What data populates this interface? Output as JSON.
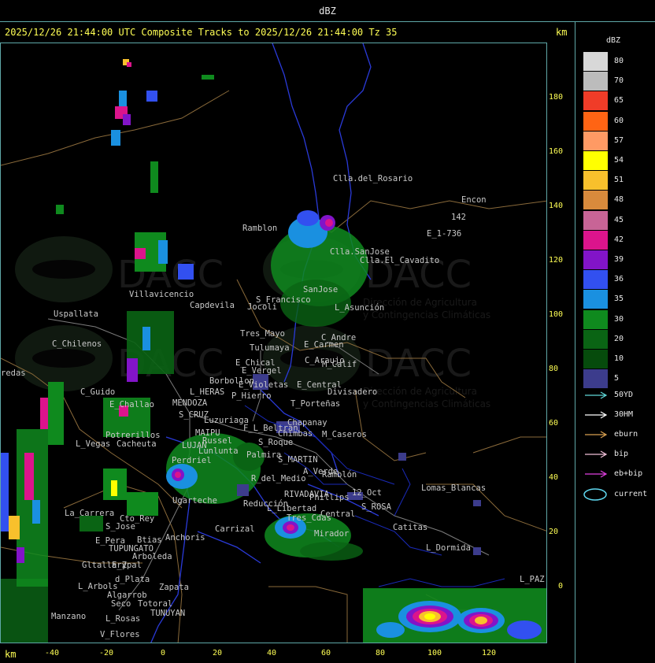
{
  "window": {
    "title": "dBZ"
  },
  "header": {
    "text": "2025/12/26 21:44:00 UTC Composite Tracks to 2025/12/26 21:44:00 Tz 35",
    "km_unit": "km",
    "km_unit_bottom": "km"
  },
  "axes": {
    "y_ticks": [
      "180",
      "160",
      "140",
      "120",
      "100",
      "80",
      "60",
      "40",
      "20",
      "0"
    ],
    "x_ticks": [
      "-40",
      "-20",
      "0",
      "20",
      "40",
      "60",
      "80",
      "100",
      "120"
    ]
  },
  "watermark": {
    "brand": "DACC",
    "line1": "Dirección de Agricultura",
    "line2": "y Contingencias Climáticas"
  },
  "places": [
    "Clla.del_Rosario",
    "Encon",
    "142",
    "E_1-736",
    "Ramblon",
    "Clla.SanJose",
    "Clla.El_Cavadito",
    "Villavicencio",
    "Capdevila",
    "S_Francisco",
    "SanJose",
    "L_Asunción",
    "Uspallata",
    "Tres_Mayo",
    "Jocoli",
    "C_Andre",
    "E_Carmen",
    "C_Chilenos",
    "Tulumaya",
    "E_Chical",
    "C_Araujo",
    "M_Calif",
    "E_Vergel",
    "Borbollon",
    "redas",
    "E_Violetas",
    "E_Central",
    "Divisadero",
    "P_Hierro",
    "L_HERAS",
    "C_Guido",
    "E_Challao",
    "MENDOZA",
    "T_Porteñas",
    "S_CRUZ",
    "Luzuriaga",
    "F_L_Beltran",
    "Chapanay",
    "Chimbas",
    "M_Caseros",
    "Potrerillos",
    "MAIPU",
    "Russel",
    "S_Roque",
    "L_Vegas",
    "Cacheuta",
    "LUJAN",
    "Lunlunta",
    "Palmira",
    "S_MARTIN",
    "Perdriel",
    "A_Verde",
    "Ramblón",
    "R_del_Medio",
    "RIVADAVIA",
    "12_Oct",
    "Lomas_Blancas",
    "Ugarteche",
    "Reducción",
    "Phillips",
    "S_ROSA",
    "La_Carrera",
    "Cto_Rey",
    "S_Jose",
    "L_Libertad",
    "Catitas",
    "Carrizal",
    "Tres_Cdas",
    "Central",
    "E_Pera",
    "Anchoris",
    "Mirador",
    "Btias",
    "TUPUNGATO",
    "L_Dormida",
    "Arboleda",
    "Gltallary",
    "E_Zpal",
    "L_Arbols",
    "d_Plata",
    "Zapata",
    "Algarrob",
    "Seco",
    "Totoral",
    "L_PAZ",
    "TUNUYAN",
    "Manzano",
    "L_Rosas",
    "V_Flores"
  ],
  "legend": {
    "title": "dBZ",
    "scale": [
      {
        "value": "80",
        "color": "#d8d8d8"
      },
      {
        "value": "70",
        "color": "#bcbcbc"
      },
      {
        "value": "65",
        "color": "#f03c28"
      },
      {
        "value": "60",
        "color": "#ff6414"
      },
      {
        "value": "57",
        "color": "#ff9a64"
      },
      {
        "value": "54",
        "color": "#ffff00"
      },
      {
        "value": "51",
        "color": "#f8c02c"
      },
      {
        "value": "48",
        "color": "#d88a3c"
      },
      {
        "value": "45",
        "color": "#c86496"
      },
      {
        "value": "42",
        "color": "#dc148c"
      },
      {
        "value": "39",
        "color": "#8214c8"
      },
      {
        "value": "36",
        "color": "#3250f0"
      },
      {
        "value": "35",
        "color": "#1a90e0"
      },
      {
        "value": "30",
        "color": "#0f8a1e"
      },
      {
        "value": "20",
        "color": "#0a6414"
      },
      {
        "value": "10",
        "color": "#064b0c"
      },
      {
        "value": "5",
        "color": "#3c3c8c"
      }
    ],
    "tracks": [
      {
        "label": "50YD",
        "color": "#5fd8d8"
      },
      {
        "label": "30HM",
        "color": "#ffffff"
      },
      {
        "label": "eburn",
        "color": "#d8a050"
      },
      {
        "label": "bip",
        "color": "#f0c0d8"
      },
      {
        "label": "eb+bip",
        "color": "#e040e0"
      }
    ],
    "current": {
      "label": "current",
      "color": "#5fd8f0"
    }
  }
}
